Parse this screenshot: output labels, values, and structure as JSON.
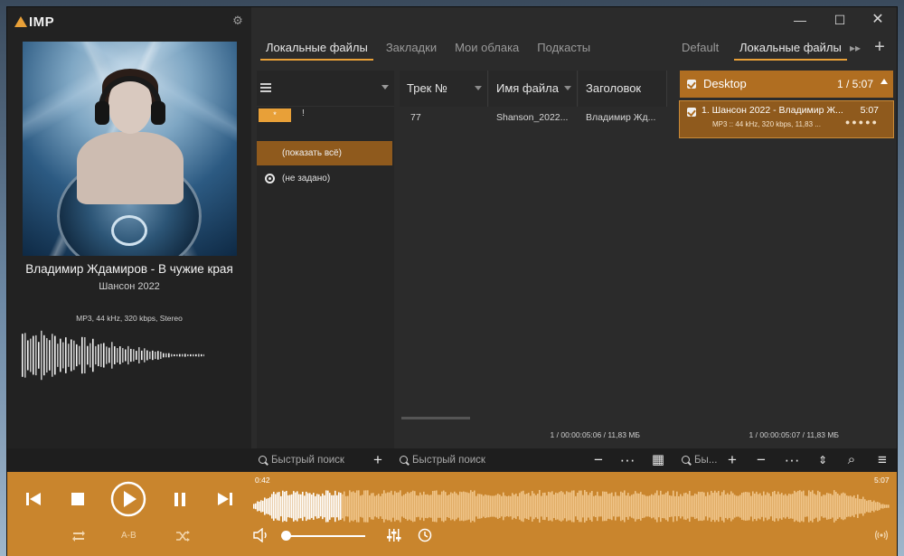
{
  "app": {
    "logo_text": "IMP"
  },
  "now_playing": {
    "title": "Владимир Ждамиров - В чужие края",
    "album": "Шансон 2022",
    "format": "MP3, 44 kHz, 320 kbps, Stereo",
    "elapsed": "0:42",
    "total": "5:07",
    "progress_fraction": 0.137
  },
  "library": {
    "tabs": [
      "Локальные файлы",
      "Закладки",
      "Мои облака",
      "Подкасты"
    ],
    "active_tab": 0,
    "filter": {
      "star_label": "*",
      "excl_label": "!",
      "items": [
        "(показать всё)",
        "(не задано)"
      ]
    },
    "columns": [
      "Трек №",
      "Имя файла",
      "Заголовок"
    ],
    "rows": [
      {
        "track": "77",
        "filename": "Shanson_2022...",
        "title": "Владимир Жд..."
      }
    ],
    "status": "1 / 00:00:05:06 / 11,83 МБ"
  },
  "playlists": {
    "tabs": [
      "Default",
      "Локальные файлы"
    ],
    "active_tab": 1,
    "group": {
      "name": "Desktop",
      "count": "1 / 5:07"
    },
    "entries": [
      {
        "title": "1. Шансон 2022 - Владимир Ж...",
        "duration": "5:07",
        "meta": "MP3 :: 44 kHz, 320 kbps, 11,83 ..."
      }
    ],
    "status": "1 / 00:00:05:07 / 11,83 МБ"
  },
  "toolbar": {
    "search_left": "Быстрый поиск",
    "search_mid": "Быстрый поиск",
    "search_right": "Бы..."
  },
  "player": {
    "ab_label": "A-B",
    "volume_fraction": 0.02
  },
  "icons": {
    "gear": "gear-icon",
    "minimize": "minimize-icon",
    "maximize": "maximize-icon",
    "close": "close-icon",
    "prev": "previous-icon",
    "stop": "stop-icon",
    "play": "play-icon",
    "pause": "pause-icon",
    "next": "next-icon",
    "repeat": "repeat-icon",
    "shuffle": "shuffle-icon",
    "volume": "speaker-icon",
    "equalizer": "equalizer-icon",
    "timer": "clock-icon",
    "search": "search-icon",
    "add": "plus-icon",
    "remove": "minus-icon",
    "more": "more-icon",
    "grid": "grid-icon",
    "menu": "hamburger-icon"
  },
  "colors": {
    "accent": "#e8a038",
    "player_bg": "#c9852d",
    "selection": "#8f5a1d",
    "group_head": "#b06e21"
  }
}
